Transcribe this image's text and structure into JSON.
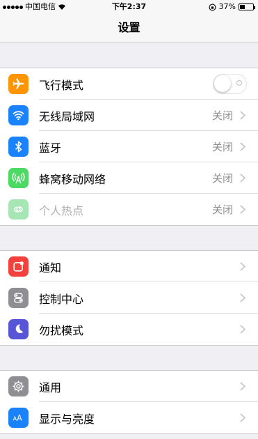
{
  "status_bar": {
    "carrier": "中国电信",
    "time": "下午2:37",
    "battery_percent": "37%",
    "battery_level": 0.37,
    "signal_dots": 5
  },
  "navbar": {
    "title": "设置"
  },
  "groups": [
    {
      "rows": [
        {
          "label": "飞行模式",
          "icon": "airplane-icon",
          "color": "#ff9500",
          "toggle": false
        },
        {
          "label": "无线局域网",
          "icon": "wifi-icon",
          "color": "#1a82fb",
          "value": "关闭"
        },
        {
          "label": "蓝牙",
          "icon": "bluetooth-icon",
          "color": "#1a82fb",
          "value": "关闭"
        },
        {
          "label": "蜂窝移动网络",
          "icon": "cellular-icon",
          "color": "#4cd964",
          "value": "关闭"
        },
        {
          "label": "个人热点",
          "icon": "hotspot-icon",
          "color": "#a6e5b4",
          "value": "关闭",
          "disabled": true
        }
      ]
    },
    {
      "rows": [
        {
          "label": "通知",
          "icon": "notification-icon",
          "color": "#f3423d"
        },
        {
          "label": "控制中心",
          "icon": "control-center-icon",
          "color": "#8e8e93"
        },
        {
          "label": "勿扰模式",
          "icon": "moon-icon",
          "color": "#5856d6"
        }
      ]
    },
    {
      "rows": [
        {
          "label": "通用",
          "icon": "gear-icon",
          "color": "#8e8e93"
        },
        {
          "label": "显示与亮度",
          "icon": "display-brightness-icon",
          "color": "#1a82fb"
        }
      ]
    }
  ]
}
